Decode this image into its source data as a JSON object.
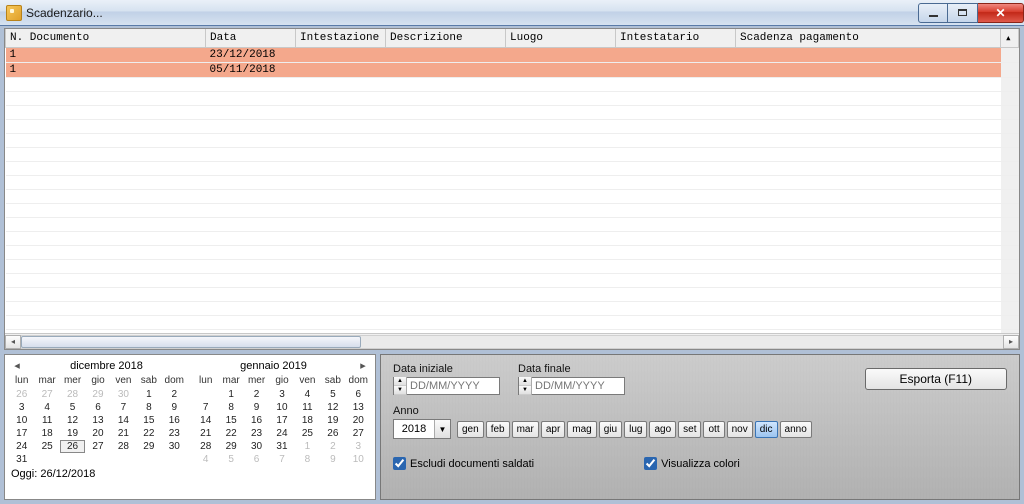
{
  "window": {
    "title": "Scadenzario..."
  },
  "grid": {
    "columns": [
      "N. Documento",
      "Data",
      "Intestazione",
      "Descrizione",
      "Luogo",
      "Intestatario",
      "Scadenza pagamento"
    ],
    "rows": [
      {
        "n": "1",
        "data": "23/12/2018",
        "intestazione": "",
        "descrizione": "",
        "luogo": "",
        "intestatario": "",
        "scadenza": ""
      },
      {
        "n": "1",
        "data": "05/11/2018",
        "intestazione": "",
        "descrizione": "",
        "luogo": "",
        "intestatario": "",
        "scadenza": ""
      }
    ]
  },
  "calendar": {
    "month1_label": "dicembre 2018",
    "month2_label": "gennaio 2019",
    "dow": [
      "lun",
      "mar",
      "mer",
      "gio",
      "ven",
      "sab",
      "dom"
    ],
    "footer": "Oggi: 26/12/2018",
    "today": 26,
    "month1_cells": [
      {
        "d": 26,
        "out": true
      },
      {
        "d": 27,
        "out": true
      },
      {
        "d": 28,
        "out": true
      },
      {
        "d": 29,
        "out": true
      },
      {
        "d": 30,
        "out": true
      },
      {
        "d": 1
      },
      {
        "d": 2
      },
      {
        "d": 3
      },
      {
        "d": 4
      },
      {
        "d": 5
      },
      {
        "d": 6
      },
      {
        "d": 7
      },
      {
        "d": 8
      },
      {
        "d": 9
      },
      {
        "d": 10
      },
      {
        "d": 11
      },
      {
        "d": 12
      },
      {
        "d": 13
      },
      {
        "d": 14
      },
      {
        "d": 15
      },
      {
        "d": 16
      },
      {
        "d": 17
      },
      {
        "d": 18
      },
      {
        "d": 19
      },
      {
        "d": 20
      },
      {
        "d": 21
      },
      {
        "d": 22
      },
      {
        "d": 23
      },
      {
        "d": 24
      },
      {
        "d": 25
      },
      {
        "d": 26,
        "today": true
      },
      {
        "d": 27
      },
      {
        "d": 28
      },
      {
        "d": 29
      },
      {
        "d": 30
      },
      {
        "d": 31
      },
      {
        "d": "",
        "out": true
      },
      {
        "d": "",
        "out": true
      },
      {
        "d": "",
        "out": true
      },
      {
        "d": "",
        "out": true
      },
      {
        "d": "",
        "out": true
      },
      {
        "d": "",
        "out": true
      }
    ],
    "month2_cells": [
      {
        "d": "",
        "out": true
      },
      {
        "d": 1
      },
      {
        "d": 2
      },
      {
        "d": 3
      },
      {
        "d": 4
      },
      {
        "d": 5
      },
      {
        "d": 6
      },
      {
        "d": 7
      },
      {
        "d": 8
      },
      {
        "d": 9
      },
      {
        "d": 10
      },
      {
        "d": 11
      },
      {
        "d": 12
      },
      {
        "d": 13
      },
      {
        "d": 14
      },
      {
        "d": 15
      },
      {
        "d": 16
      },
      {
        "d": 17
      },
      {
        "d": 18
      },
      {
        "d": 19
      },
      {
        "d": 20
      },
      {
        "d": 21
      },
      {
        "d": 22
      },
      {
        "d": 23
      },
      {
        "d": 24
      },
      {
        "d": 25
      },
      {
        "d": 26
      },
      {
        "d": 27
      },
      {
        "d": 28
      },
      {
        "d": 29
      },
      {
        "d": 30
      },
      {
        "d": 31
      },
      {
        "d": 1,
        "out": true
      },
      {
        "d": 2,
        "out": true
      },
      {
        "d": 3,
        "out": true
      },
      {
        "d": 4,
        "out": true
      },
      {
        "d": 5,
        "out": true
      },
      {
        "d": 6,
        "out": true
      },
      {
        "d": 7,
        "out": true
      },
      {
        "d": 8,
        "out": true
      },
      {
        "d": 9,
        "out": true
      },
      {
        "d": 10,
        "out": true
      }
    ]
  },
  "filters": {
    "date_start_label": "Data iniziale",
    "date_end_label": "Data finale",
    "date_placeholder": "DD/MM/YYYY",
    "export_label": "Esporta (F11)",
    "year_label": "Anno",
    "year_value": "2018",
    "months": [
      "gen",
      "feb",
      "mar",
      "apr",
      "mag",
      "giu",
      "lug",
      "ago",
      "set",
      "ott",
      "nov",
      "dic",
      "anno"
    ],
    "active_month": "dic",
    "chk_saldati": "Escludi documenti saldati",
    "chk_colori": "Visualizza colori"
  }
}
